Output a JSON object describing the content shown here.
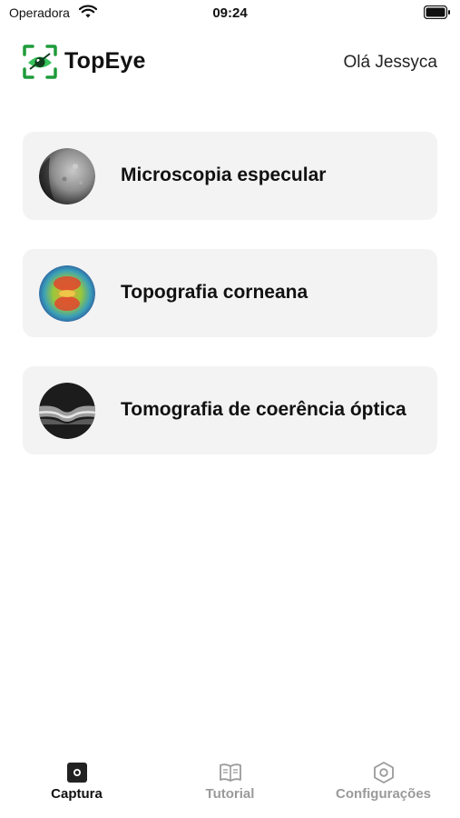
{
  "status_bar": {
    "carrier": "Operadora",
    "time": "09:24"
  },
  "header": {
    "app_name": "TopEye",
    "greeting": "Olá Jessyca"
  },
  "cards": [
    {
      "label": "Microscopia especular",
      "icon": "specular-microscopy-thumbnail"
    },
    {
      "label": "Topografia corneana",
      "icon": "corneal-topography-thumbnail"
    },
    {
      "label": "Tomografia de coerência óptica",
      "icon": "oct-thumbnail"
    }
  ],
  "tabs": [
    {
      "label": "Captura",
      "icon": "camera-icon",
      "active": true
    },
    {
      "label": "Tutorial",
      "icon": "book-icon",
      "active": false
    },
    {
      "label": "Configurações",
      "icon": "settings-hexagon-icon",
      "active": false
    }
  ],
  "colors": {
    "accent": "#22b14c",
    "inactive": "#9a9a9a",
    "card_bg": "#f3f3f3"
  }
}
